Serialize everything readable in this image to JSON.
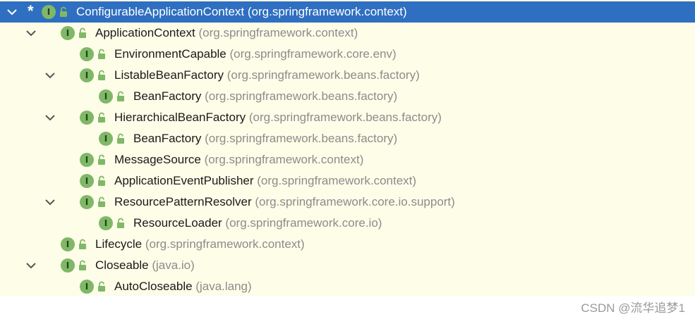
{
  "tree": {
    "rows": [
      {
        "name": "ConfigurableApplicationContext",
        "pkg": "(org.springframework.context)",
        "depth": 0,
        "expanded": true,
        "selected": true,
        "marker": "*"
      },
      {
        "name": "ApplicationContext",
        "pkg": "(org.springframework.context)",
        "depth": 1,
        "expanded": true
      },
      {
        "name": "EnvironmentCapable",
        "pkg": "(org.springframework.core.env)",
        "depth": 2,
        "expanded": false
      },
      {
        "name": "ListableBeanFactory",
        "pkg": "(org.springframework.beans.factory)",
        "depth": 2,
        "expanded": true
      },
      {
        "name": "BeanFactory",
        "pkg": "(org.springframework.beans.factory)",
        "depth": 3,
        "expanded": false
      },
      {
        "name": "HierarchicalBeanFactory",
        "pkg": "(org.springframework.beans.factory)",
        "depth": 2,
        "expanded": true
      },
      {
        "name": "BeanFactory",
        "pkg": "(org.springframework.beans.factory)",
        "depth": 3,
        "expanded": false
      },
      {
        "name": "MessageSource",
        "pkg": "(org.springframework.context)",
        "depth": 2,
        "expanded": false
      },
      {
        "name": "ApplicationEventPublisher",
        "pkg": "(org.springframework.context)",
        "depth": 2,
        "expanded": false
      },
      {
        "name": "ResourcePatternResolver",
        "pkg": "(org.springframework.core.io.support)",
        "depth": 2,
        "expanded": true
      },
      {
        "name": "ResourceLoader",
        "pkg": "(org.springframework.core.io)",
        "depth": 3,
        "expanded": false
      },
      {
        "name": "Lifecycle",
        "pkg": "(org.springframework.context)",
        "depth": 1,
        "expanded": false
      },
      {
        "name": "Closeable",
        "pkg": "(java.io)",
        "depth": 1,
        "expanded": true
      },
      {
        "name": "AutoCloseable",
        "pkg": "(java.lang)",
        "depth": 2,
        "expanded": false
      }
    ],
    "interface_icon_letter": "I"
  },
  "watermark": "CSDN @流华追梦1",
  "colors": {
    "selection": "#2f6fc1",
    "background": "#fdfde8",
    "interface_icon": "#7fb867",
    "lock_icon": "#7fb867",
    "package_text": "#8c8c8c"
  }
}
